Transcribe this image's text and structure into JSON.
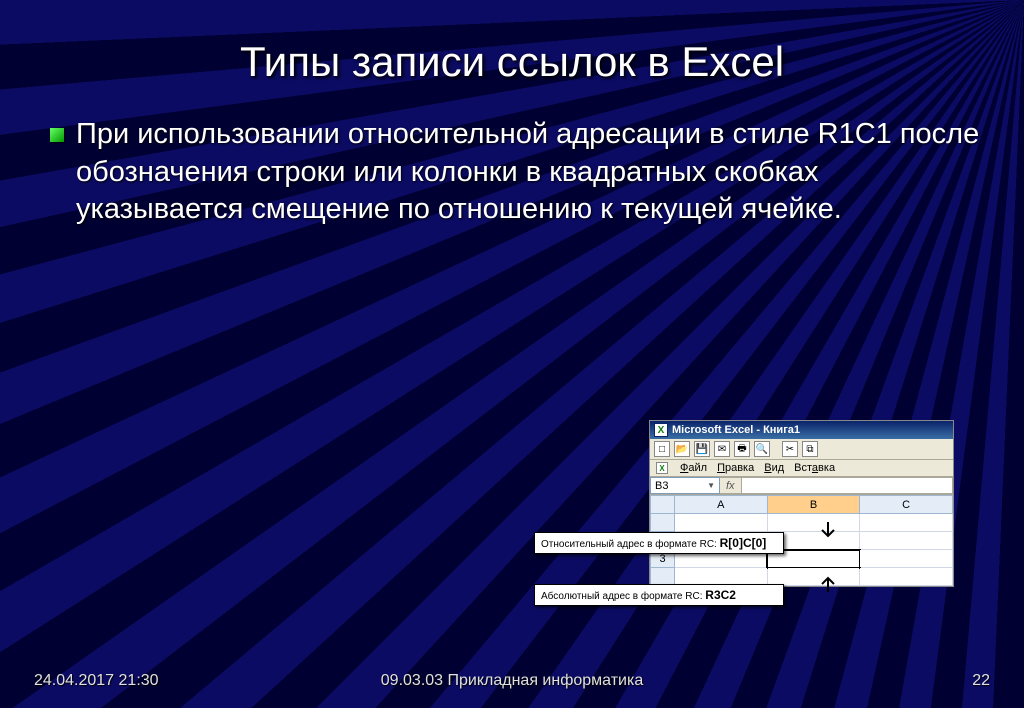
{
  "title": "Типы записи ссылок в Excel",
  "bullet_text": "При использовании относительной адресации в стиле R1C1 после обозначения строки или колонки в квадратных скобках указывается смещение по отношению к текущей ячейке.",
  "excel": {
    "window_title": "Microsoft Excel - Книга1",
    "menu": {
      "file": "Файл",
      "edit": "Правка",
      "view": "Вид",
      "insert": "Вставка"
    },
    "namebox": "B3",
    "fx_label": "fx",
    "columns": [
      "A",
      "B",
      "C"
    ],
    "row_label": "3",
    "selected_cell": "B3"
  },
  "callouts": {
    "relative_label": "Относительный адрес в формате RC:",
    "relative_value": "R[0]C[0]",
    "absolute_label": "Абсолютный адрес в формате RC:",
    "absolute_value": "R3C2"
  },
  "footer": {
    "date": "24.04.2017 21:30",
    "course": "09.03.03 Прикладная информатика",
    "page": "22"
  }
}
